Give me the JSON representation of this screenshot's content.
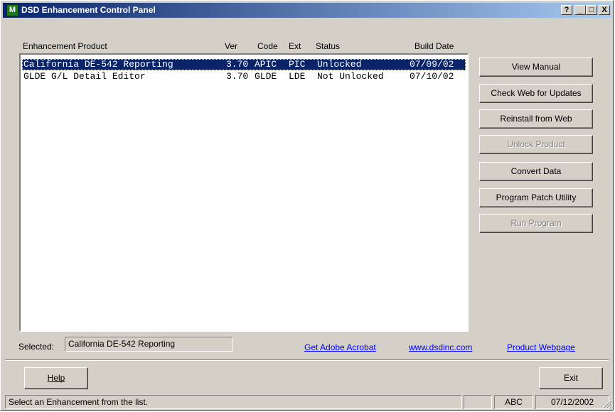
{
  "window": {
    "title": "DSD Enhancement Control Panel",
    "app_icon_letter": "M",
    "controls": [
      "?",
      "_",
      "□",
      "X"
    ]
  },
  "list": {
    "headers": {
      "product": "Enhancement Product",
      "ver": "Ver",
      "code": "Code",
      "ext": "Ext",
      "status": "Status",
      "build_date": "Build Date"
    },
    "rows": [
      {
        "product": "California DE-542 Reporting",
        "ver": "3.70",
        "code": "APIC",
        "ext": "PIC",
        "status": "Unlocked",
        "build_date": "07/09/02",
        "selected": true
      },
      {
        "product": "GLDE G/L Detail Editor",
        "ver": "3.70",
        "code": "GLDE",
        "ext": "LDE",
        "status": "Not Unlocked",
        "build_date": "07/10/02",
        "selected": false
      }
    ]
  },
  "buttons": {
    "view_manual": "View Manual",
    "check_web": "Check Web for Updates",
    "reinstall": "Reinstall from Web",
    "unlock": "Unlock Product",
    "convert": "Convert Data",
    "patch": "Program Patch Utility",
    "run": "Run Program"
  },
  "selected": {
    "label": "Selected:",
    "value": "California DE-542 Reporting"
  },
  "links": {
    "acrobat": "Get Adobe Acrobat",
    "website": "www.dsdinc.com",
    "webpage": "Product Webpage"
  },
  "bottom": {
    "help": "Help",
    "exit": "Exit"
  },
  "statusbar": {
    "message": "Select an Enhancement from the list.",
    "mode": "ABC",
    "date": "07/12/2002"
  }
}
